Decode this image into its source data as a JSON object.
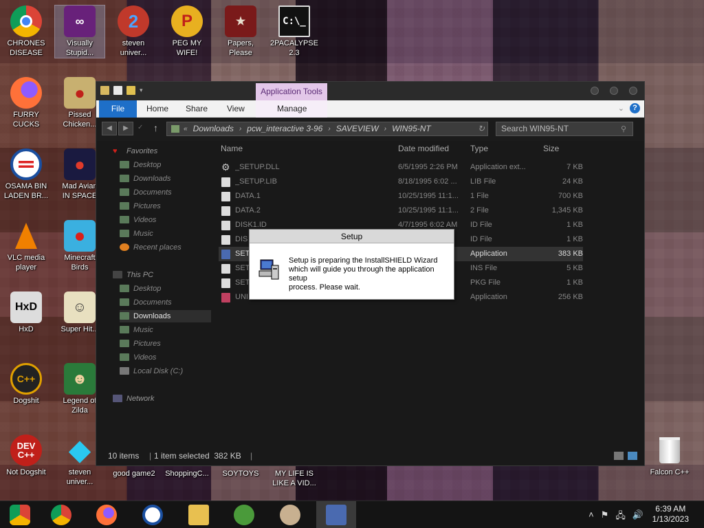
{
  "desktop": {
    "icons": [
      {
        "label": "CHRONES\nDISEASE",
        "icon": "chrome-icon"
      },
      {
        "label": "Visually\nStupid...",
        "icon": "visual-studio-icon"
      },
      {
        "label": "steven\nuniver...",
        "icon": "steven-universe-icon"
      },
      {
        "label": "PEG MY WIFE!",
        "icon": "peggle-icon"
      },
      {
        "label": "Papers,\nPlease",
        "icon": "papers-please-icon"
      },
      {
        "label": "2PACALYPSE\n2.3",
        "icon": "console-icon"
      },
      {
        "label": "FURRY CUCKS",
        "icon": "firefox-icon"
      },
      {
        "label": "Pissed\nChicken...",
        "icon": "angry-birds-seasons-icon"
      },
      {
        "label": "OSAMA BIN\nLADEN BR...",
        "icon": "obama-icon"
      },
      {
        "label": "Mad Avian\nIN SPACE",
        "icon": "angry-birds-space-icon"
      },
      {
        "label": "VLC media\nplayer",
        "icon": "vlc-icon"
      },
      {
        "label": "Minecraft\nBirds",
        "icon": "angry-birds-icon"
      },
      {
        "label": "HxD",
        "icon": "hxd-icon"
      },
      {
        "label": "Super Hit...",
        "icon": "super-hit-icon"
      },
      {
        "label": "Dogshit",
        "icon": "cpp-icon"
      },
      {
        "label": "Legend of\nZilda",
        "icon": "zelda-icon"
      },
      {
        "label": "Not Dogshit",
        "icon": "dev-cpp-icon"
      },
      {
        "label": "steven\nuniver...",
        "icon": "diamond-icon"
      },
      {
        "label": "Falcon C++",
        "icon": "recycle-bin-icon"
      }
    ],
    "bottom_labels": [
      "good game2",
      "ShoppingC...",
      "SOYTOYS",
      "MY LIFE IS\nLIKE A VID..."
    ]
  },
  "explorer": {
    "app_tools": "Application Tools",
    "tabs": [
      "File",
      "Home",
      "Share",
      "View",
      "Manage"
    ],
    "address": [
      "Downloads",
      "pcw_interactive 3-96",
      "SAVEVIEW",
      "WIN95-NT"
    ],
    "search_placeholder": "Search WIN95-NT",
    "nav": {
      "favorites": "Favorites",
      "fav_items": [
        "Desktop",
        "Downloads",
        "Documents",
        "Pictures",
        "Videos",
        "Music",
        "Recent places"
      ],
      "this_pc": "This PC",
      "pc_items": [
        "Desktop",
        "Documents",
        "Downloads",
        "Music",
        "Pictures",
        "Videos",
        "Local Disk (C:)"
      ],
      "network": "Network"
    },
    "columns": [
      "Name",
      "Date modified",
      "Type",
      "Size"
    ],
    "files": [
      {
        "name": "_SETUP.DLL",
        "date": "6/5/1995 2:26 PM",
        "type": "Application ext...",
        "size": "7 KB"
      },
      {
        "name": "_SETUP.LIB",
        "date": "8/18/1995 6:02 ...",
        "type": "LIB File",
        "size": "24 KB"
      },
      {
        "name": "DATA.1",
        "date": "10/25/1995 11:1...",
        "type": "1 File",
        "size": "700 KB"
      },
      {
        "name": "DATA.2",
        "date": "10/25/1995 11:1...",
        "type": "2 File",
        "size": "1,345 KB"
      },
      {
        "name": "DISK1.ID",
        "date": "4/7/1995 6:02 AM",
        "type": "ID File",
        "size": "1 KB"
      },
      {
        "name": "DIS",
        "date": "",
        "type": "ID File",
        "size": "1 KB"
      },
      {
        "name": "SET",
        "date": "",
        "type": "Application",
        "size": "383 KB"
      },
      {
        "name": "SET",
        "date": "",
        "type": "INS File",
        "size": "5 KB"
      },
      {
        "name": "SET",
        "date": "",
        "type": "PKG File",
        "size": "1 KB"
      },
      {
        "name": "UNI",
        "date": "",
        "type": "Application",
        "size": "256 KB"
      }
    ],
    "status": {
      "items": "10 items",
      "selected": "1 item selected  382 KB"
    }
  },
  "setup": {
    "title": "Setup",
    "message": "Setup is preparing the InstallSHIELD Wizard\nwhich will guide you through the application setup\nprocess.  Please wait."
  },
  "taskbar": {
    "time": "6:39 AM",
    "date": "1/13/2023"
  }
}
